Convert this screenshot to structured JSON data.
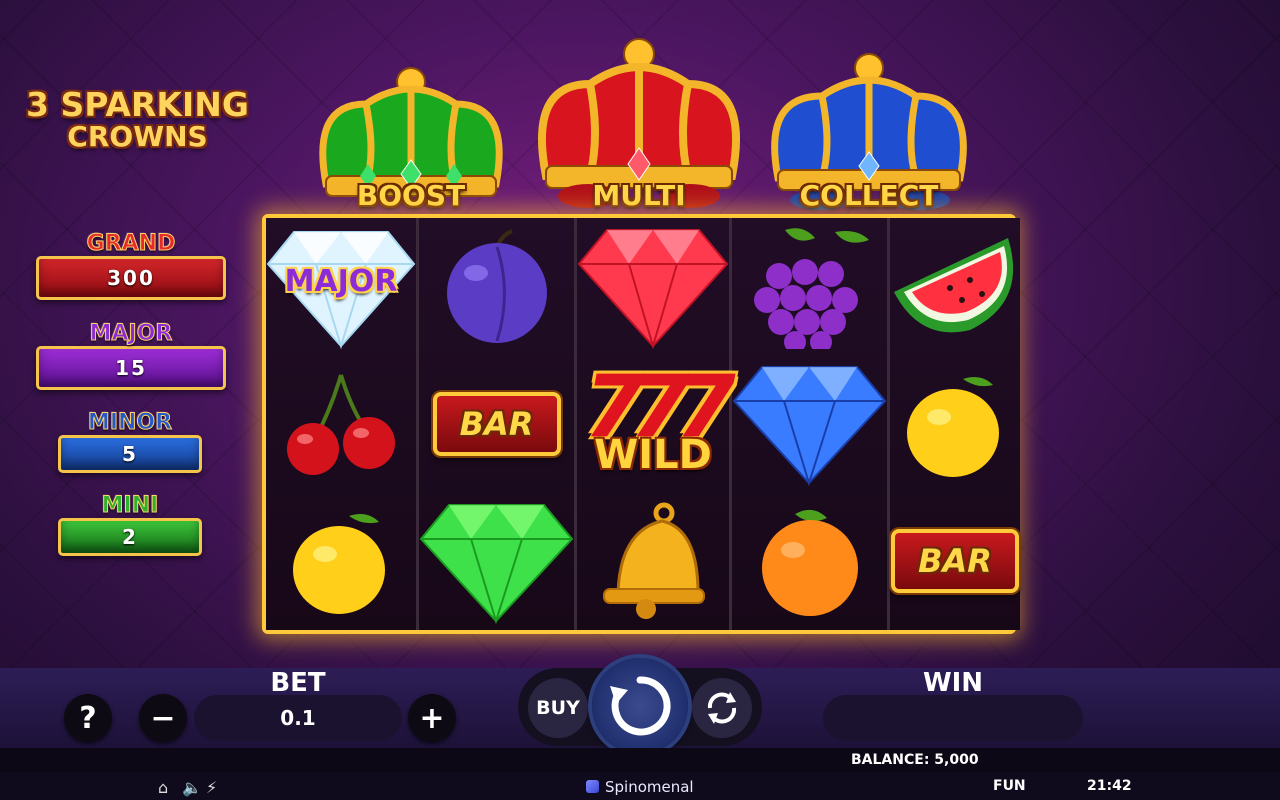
{
  "logo": {
    "line1": "3 SPARKING",
    "line2": "CROWNS"
  },
  "jackpots": {
    "grand": {
      "label": "GRAND",
      "value": "300"
    },
    "major": {
      "label": "MAJOR",
      "value": "15"
    },
    "minor": {
      "label": "MINOR",
      "value": "5"
    },
    "mini": {
      "label": "MINI",
      "value": "2"
    }
  },
  "crowns": {
    "boost": {
      "label": "BOOST",
      "color": "#1aa81e"
    },
    "multi": {
      "label": "MULTI",
      "color": "#d8141e"
    },
    "collect": {
      "label": "COLLECT",
      "color": "#1f4fd0"
    }
  },
  "reels": [
    [
      "diamond-white-major",
      "plum",
      "cherry",
      "lemon"
    ],
    [
      "plum",
      "bar",
      "gem-green"
    ],
    [
      "gem-red",
      "wild",
      "bell"
    ],
    [
      "grapes",
      "diamond-blue",
      "orange"
    ],
    [
      "watermelon",
      "lemon",
      "bar"
    ]
  ],
  "symbol_text": {
    "major": "MAJOR",
    "bar": "BAR",
    "wild_sevens": "777",
    "wild": "WILD"
  },
  "controls": {
    "help": "?",
    "minus": "−",
    "plus": "+",
    "bet_title": "BET",
    "bet_value": "0.1",
    "buy": "BUY",
    "win_title": "WIN",
    "win_value": ""
  },
  "footer": {
    "balance": "BALANCE: 5,000",
    "brand": "Spinomenal",
    "mode": "FUN",
    "time": "21:42"
  }
}
